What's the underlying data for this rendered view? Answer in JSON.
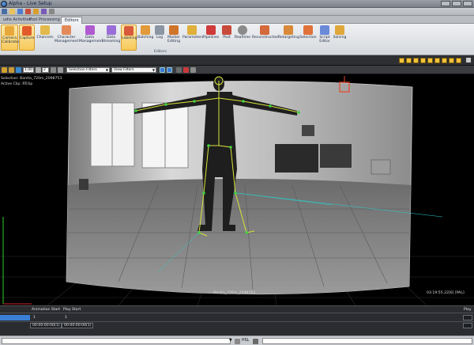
{
  "window": {
    "title": "Alpha - Live Setup"
  },
  "tabs": [
    "udio Activities",
    "Post Processing",
    "Editors"
  ],
  "ribbon": {
    "buttons": [
      {
        "label": "Camera Calibration",
        "icon": "camera-calibration-icon"
      },
      {
        "label": "Capture",
        "icon": "capture-icon"
      },
      {
        "label": "Channels",
        "icon": "channels-icon"
      },
      {
        "label": "Character Management",
        "icon": "character-icon"
      },
      {
        "label": "Data Management",
        "icon": "data-management-icon"
      },
      {
        "label": "Data Streaming",
        "icon": "data-streaming-icon"
      },
      {
        "label": "Labeling",
        "icon": "labeling-icon"
      },
      {
        "label": "Batching",
        "icon": "batching-icon"
      },
      {
        "label": "Log",
        "icon": "log-icon"
      },
      {
        "label": "Marker Editing",
        "icon": "marker-editing-icon"
      },
      {
        "label": "Parameters",
        "icon": "parameters-icon"
      },
      {
        "label": "Pipelines",
        "icon": "pipelines-icon"
      },
      {
        "label": "Post",
        "icon": "post-icon"
      },
      {
        "label": "Realtime",
        "icon": "realtime-icon"
      },
      {
        "label": "Reconstruction",
        "icon": "reconstruction-icon"
      },
      {
        "label": "Retargeting",
        "icon": "retargeting-icon"
      },
      {
        "label": "Selection",
        "icon": "selection-icon"
      },
      {
        "label": "Script Editor",
        "icon": "script-editor-icon"
      },
      {
        "label": "Solving",
        "icon": "solving-icon"
      }
    ],
    "group_label": "Editors"
  },
  "toolbar": {
    "frame_value": "1.00",
    "step_value": "2",
    "selection_filters": "Selection Filters",
    "view_filters": "View Filters"
  },
  "viewport": {
    "selection": "Selection: Bonita_720m_2098753",
    "active_clip": "Active Clip: RTclip",
    "camera_label": "Bonita_720m_2098753",
    "timecode": "03:19:55.22[6] [PAL]"
  },
  "timeline": {
    "col_animation_start": "Animation Start",
    "col_play_start": "Play Start",
    "col_play_right": "Play",
    "animation_start_value": "1",
    "play_start_value": "1",
    "animation_start_tc": "00:00:00:00(1)",
    "play_start_tc": "00:00:00:00(1)"
  },
  "status": {
    "hsl_label": "HSL"
  },
  "colors": {
    "skeleton": "#d8e43a",
    "marker": "#3fd03f",
    "grid": "#3a3a3a",
    "ribbon_active": "#f7c95b"
  }
}
